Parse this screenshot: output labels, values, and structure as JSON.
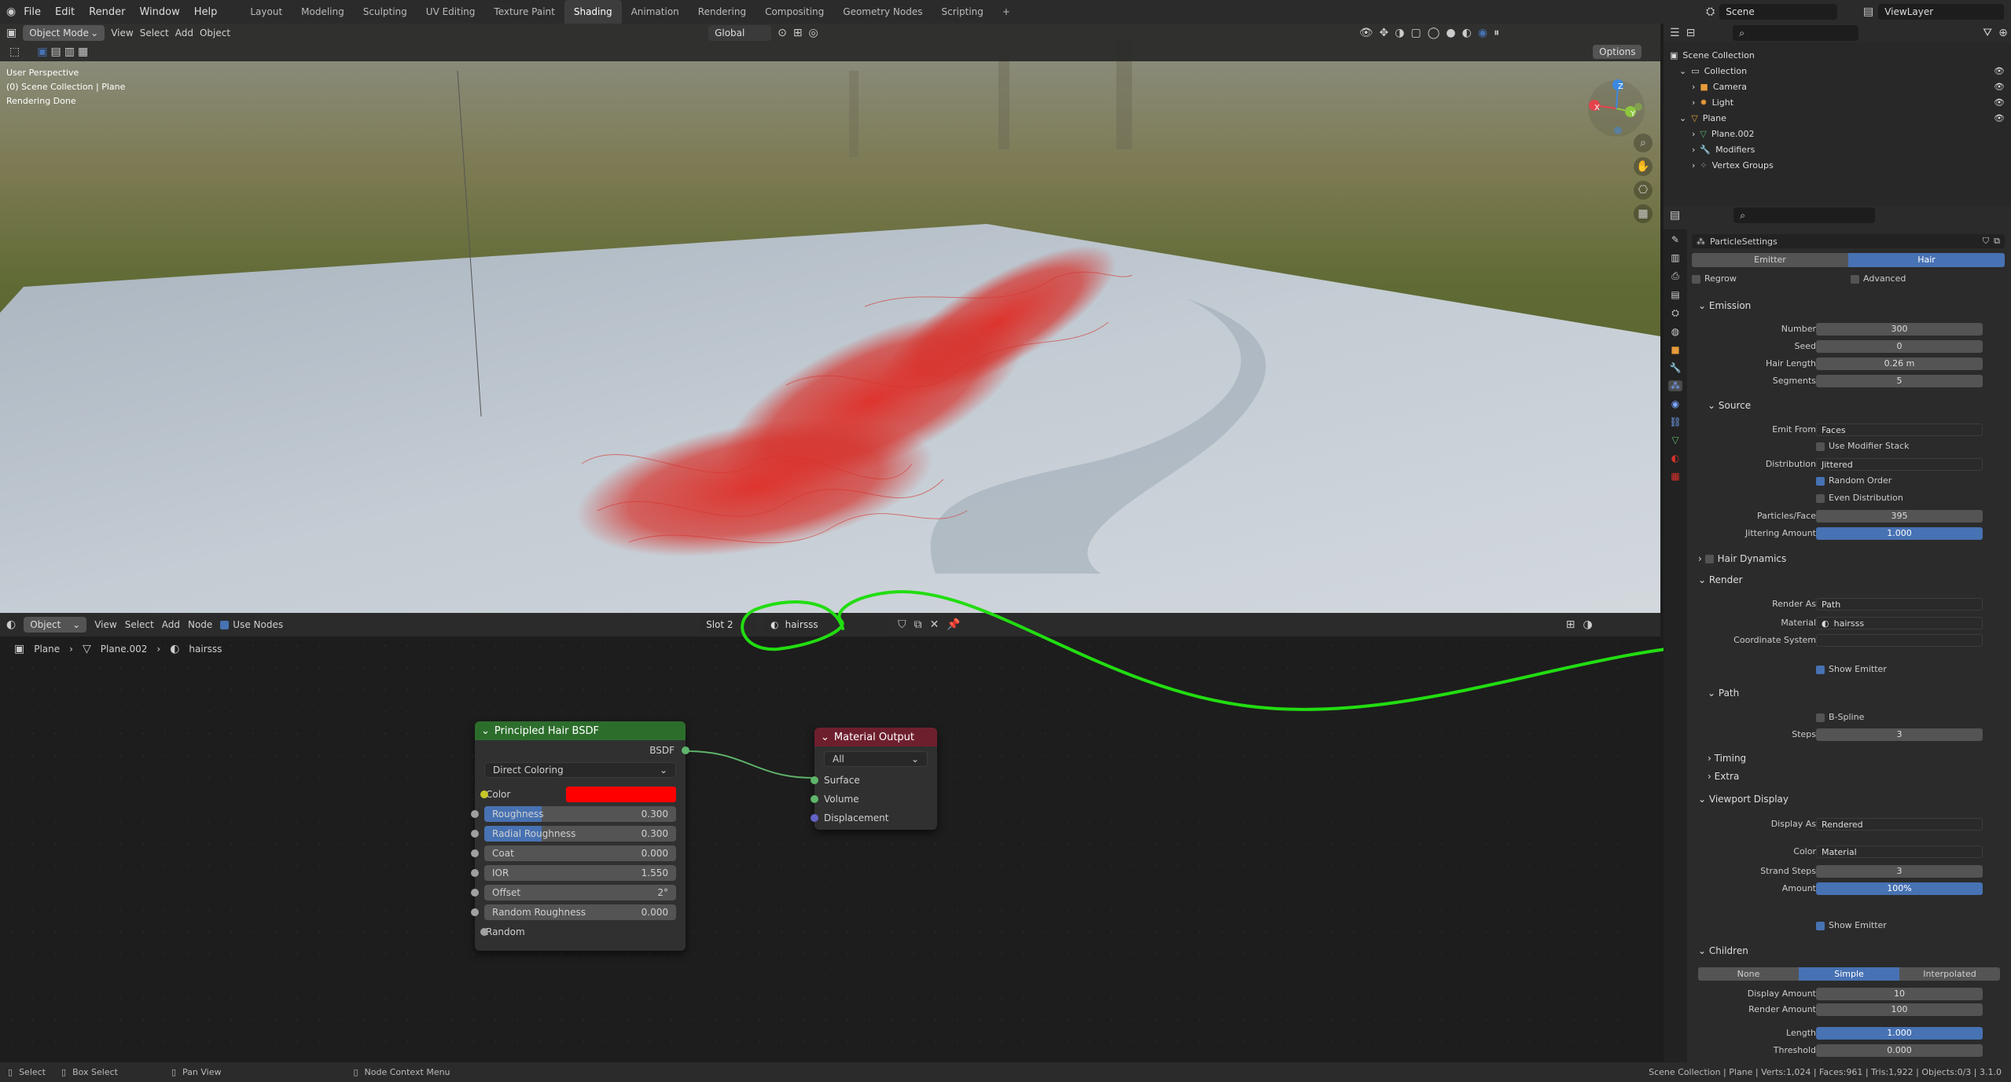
{
  "topbar": {
    "menus": [
      "File",
      "Edit",
      "Render",
      "Window",
      "Help"
    ],
    "workspaces": [
      "Layout",
      "Modeling",
      "Sculpting",
      "UV Editing",
      "Texture Paint",
      "Shading",
      "Animation",
      "Rendering",
      "Compositing",
      "Geometry Nodes",
      "Scripting"
    ],
    "active_workspace": "Shading",
    "add_tab": "+",
    "scene": "Scene",
    "view_layer": "ViewLayer"
  },
  "viewport": {
    "mode": "Object Mode",
    "menus": [
      "View",
      "Select",
      "Add",
      "Object"
    ],
    "transform": "Global",
    "options": "Options",
    "info": [
      "User Perspective",
      "(0) Scene Collection | Plane",
      "Rendering Done"
    ],
    "gizmo_axes": [
      "X",
      "Y",
      "Z"
    ],
    "hair_color": "#d6322b"
  },
  "node_editor": {
    "editor_type": "Object",
    "menus": [
      "View",
      "Select",
      "Add",
      "Node"
    ],
    "use_nodes": "Use Nodes",
    "slot": "Slot 2",
    "material": "hairsss",
    "breadcrumb": [
      "Plane",
      "Plane.002",
      "hairsss"
    ],
    "hair_node": {
      "title": "Principled Hair BSDF",
      "output": "BSDF",
      "mode": "Direct Coloring",
      "color_label": "Color",
      "color": "#ff0000",
      "props": [
        {
          "label": "Roughness",
          "value": "0.300",
          "fill": 0.3
        },
        {
          "label": "Radial Roughness",
          "value": "0.300",
          "fill": 0.3
        },
        {
          "label": "Coat",
          "value": "0.000",
          "fill": 0
        },
        {
          "label": "IOR",
          "value": "1.550",
          "fill": 0
        },
        {
          "label": "Offset",
          "value": "2°",
          "fill": 0
        },
        {
          "label": "Random Roughness",
          "value": "0.000",
          "fill": 0
        }
      ],
      "random_label": "Random"
    },
    "output_node": {
      "title": "Material Output",
      "target": "All",
      "inputs": [
        "Surface",
        "Volume",
        "Displacement"
      ]
    }
  },
  "outliner": {
    "root": "Scene Collection",
    "items": [
      {
        "name": "Collection",
        "level": 1
      },
      {
        "name": "Camera",
        "level": 2
      },
      {
        "name": "Light",
        "level": 2
      },
      {
        "name": "Plane",
        "level": 1
      },
      {
        "name": "Plane.002",
        "level": 2
      },
      {
        "name": "Modifiers",
        "level": 2
      },
      {
        "name": "Vertex Groups",
        "level": 2
      }
    ]
  },
  "properties": {
    "datablock": "ParticleSettings",
    "type_tabs": [
      "Emitter",
      "Hair"
    ],
    "active_type": "Hair",
    "regrow": "Regrow",
    "advanced": "Advanced",
    "emission": {
      "title": "Emission",
      "fields": [
        {
          "label": "Number",
          "value": "300"
        },
        {
          "label": "Seed",
          "value": "0"
        },
        {
          "label": "Hair Length",
          "value": "0.26 m"
        },
        {
          "label": "Segments",
          "value": "5"
        }
      ]
    },
    "source": {
      "title": "Source",
      "emit_from_label": "Emit From",
      "emit_from": "Faces",
      "use_modifier_stack": "Use Modifier Stack",
      "distribution_label": "Distribution",
      "distribution": "Jittered",
      "random_order": "Random Order",
      "even_distribution": "Even Distribution",
      "particles_face_label": "Particles/Face",
      "particles_face": "395",
      "jitter_label": "Jittering Amount",
      "jitter": "1.000"
    },
    "hair_dynamics": "Hair Dynamics",
    "render": {
      "title": "Render",
      "render_as_label": "Render As",
      "render_as": "Path",
      "material_label": "Material",
      "material": "hairsss",
      "coord_label": "Coordinate System",
      "show_emitter": "Show Emitter"
    },
    "path": {
      "title": "Path",
      "bspline": "B-Spline",
      "steps_label": "Steps",
      "steps": "3"
    },
    "timing": "Timing",
    "extra": "Extra",
    "viewport_display": {
      "title": "Viewport Display",
      "display_as_label": "Display As",
      "display_as": "Rendered",
      "color_label": "Color",
      "color": "Material",
      "strand_steps_label": "Strand Steps",
      "strand_steps": "3",
      "amount_label": "Amount",
      "amount": "100%",
      "show_emitter": "Show Emitter"
    },
    "children": {
      "title": "Children",
      "modes": [
        "None",
        "Simple",
        "Interpolated"
      ],
      "active": "Simple",
      "display_amount_label": "Display Amount",
      "display_amount": "10",
      "render_amount_label": "Render Amount",
      "render_amount": "100",
      "length_label": "Length",
      "length": "1.000",
      "threshold_label": "Threshold",
      "threshold": "0.000"
    }
  },
  "statusbar": {
    "left": [
      "Select",
      "Box Select",
      "Pan View",
      "Node Context Menu"
    ],
    "right": "Scene Collection | Plane | Verts:1,024 | Faces:961 | Tris:1,922 | Objects:0/3 | 3.1.0"
  },
  "annotation_color": "#22dd11"
}
